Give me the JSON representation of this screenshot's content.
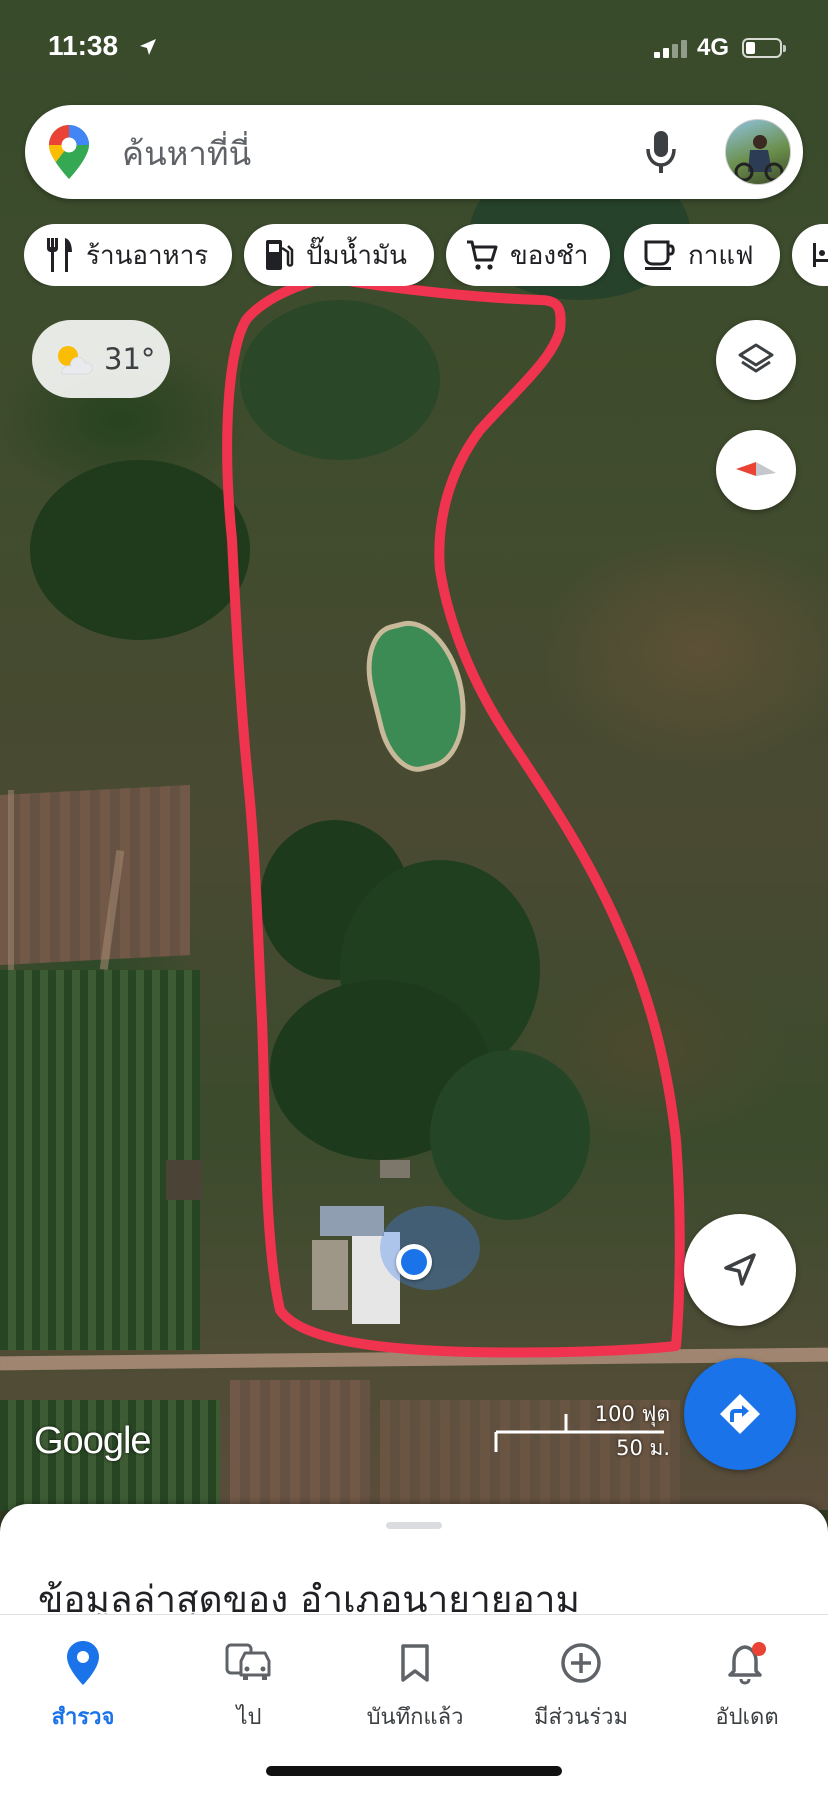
{
  "status_bar": {
    "time": "11:38",
    "network": "4G"
  },
  "search": {
    "placeholder": "ค้นหาที่นี่"
  },
  "chips": [
    {
      "label": "ร้านอาหาร",
      "icon": "restaurant-icon"
    },
    {
      "label": "ปั๊มน้ำมัน",
      "icon": "gas-station-icon"
    },
    {
      "label": "ของชำ",
      "icon": "cart-icon"
    },
    {
      "label": "กาแฟ",
      "icon": "coffee-icon"
    }
  ],
  "weather": {
    "temperature": "31°",
    "icon": "partly-sunny-icon"
  },
  "map": {
    "attribution": "Google",
    "scale_feet": "100 ฟุต",
    "scale_meters": "50 ม.",
    "annotation_color": "#f0334f",
    "location_dot_color": "#1a73e8"
  },
  "sheet": {
    "title": "ข้อมูลล่าสุดของ อำเภอนายายอาม"
  },
  "bottom_nav": [
    {
      "label": "สำรวจ",
      "icon": "explore-pin-icon",
      "active": true
    },
    {
      "label": "ไป",
      "icon": "commute-car-icon",
      "active": false
    },
    {
      "label": "บันทึกแล้ว",
      "icon": "bookmark-icon",
      "active": false
    },
    {
      "label": "มีส่วนร่วม",
      "icon": "add-circle-icon",
      "active": false
    },
    {
      "label": "อัปเดต",
      "icon": "bell-icon",
      "active": false
    }
  ],
  "colors": {
    "accent": "#1a73e8",
    "notification_dot": "#ea4335"
  }
}
